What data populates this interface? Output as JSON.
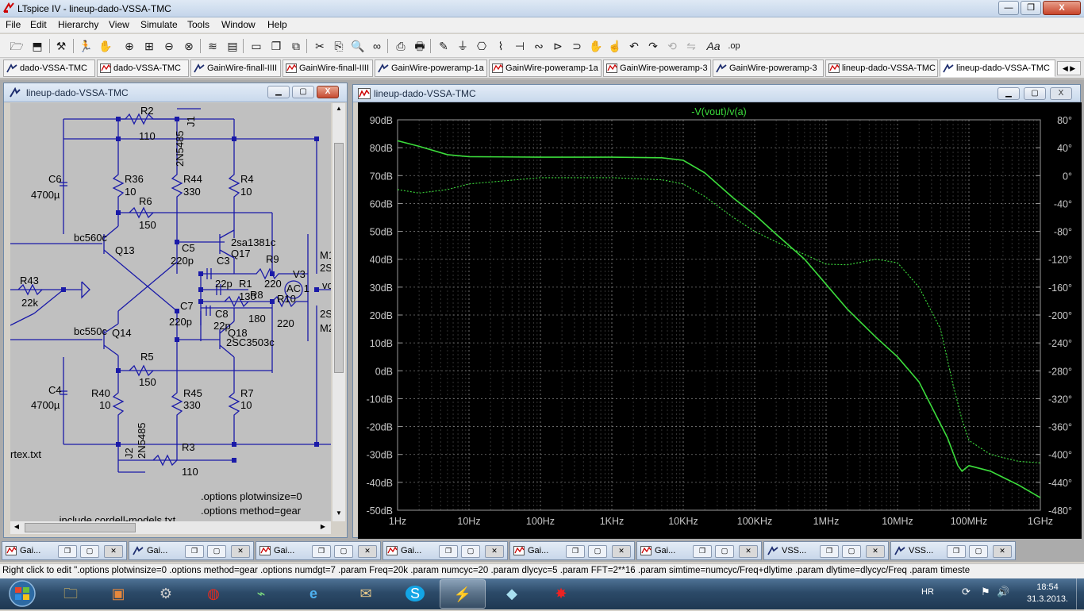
{
  "app": {
    "title": "LTspice IV - lineup-dado-VSSA-TMC",
    "window_buttons": {
      "minimize": "—",
      "maximize": "❐",
      "close": "X"
    }
  },
  "menu": [
    "File",
    "Edit",
    "Hierarchy",
    "View",
    "Simulate",
    "Tools",
    "Window",
    "Help"
  ],
  "toolbar": {
    "icons": [
      "open-icon",
      "save-icon",
      "settings-icon",
      "run-icon",
      "pan-icon",
      "zoom-in-icon",
      "zoom-area-icon",
      "zoom-out-icon",
      "zoom-cancel-icon",
      "autorange-icon",
      "tile-icon",
      "cascade-icon",
      "close-windows-icon",
      "cut-icon",
      "copy-icon",
      "find-icon",
      "binoculars-icon",
      "print-preview-icon",
      "print-icon",
      "draw-wire-icon",
      "ground-icon",
      "label-net-icon",
      "resistor-icon",
      "capacitor-icon",
      "inductor-icon",
      "diode-icon",
      "component-icon",
      "move-icon",
      "drag-icon",
      "undo-icon",
      "redo-icon",
      "rotate-icon",
      "mirror-icon",
      "text-icon",
      "spice-directive-icon"
    ],
    "text_buttons": {
      "text": "Aa",
      "directive": ".op"
    }
  },
  "doc_tabs": [
    {
      "label": "dado-VSSA-TMC",
      "type": "schematic"
    },
    {
      "label": "dado-VSSA-TMC",
      "type": "plot"
    },
    {
      "label": "GainWire-finall-IIII",
      "type": "schematic"
    },
    {
      "label": "GainWire-finall-IIII",
      "type": "plot"
    },
    {
      "label": "GainWire-poweramp-1a",
      "type": "schematic"
    },
    {
      "label": "GainWire-poweramp-1a",
      "type": "plot"
    },
    {
      "label": "GainWire-poweramp-3",
      "type": "plot"
    },
    {
      "label": "GainWire-poweramp-3",
      "type": "schematic"
    },
    {
      "label": "lineup-dado-VSSA-TMC",
      "type": "plot"
    },
    {
      "label": "lineup-dado-VSSA-TMC",
      "type": "schematic",
      "active": true
    }
  ],
  "schematic_window": {
    "title": "lineup-dado-VSSA-TMC",
    "labels": {
      "R2": "R2",
      "R2v": "110",
      "J1": "J1",
      "J1m": "2N5485",
      "C6": "C6",
      "C6v": "4700µ",
      "R36": "R36",
      "R36v": "10",
      "R44": "R44",
      "R44v": "330",
      "R4": "R4",
      "R4v": "10",
      "R6": "R6",
      "R6v": "150",
      "Q13m": "bc560c",
      "Q13": "Q13",
      "Q17m": "2sa1381c",
      "Q17": "Q17",
      "C5": "C5",
      "C5v": "220p",
      "C3": "C3",
      "C3v": "22p",
      "R9": "R9",
      "R9v": "220",
      "V3": "V3",
      "AC": "AC 1",
      "M1": "M1",
      "S1": "2S",
      "vo": "vo",
      "R43": "R43",
      "R43v": "22k",
      "R1": "R1",
      "R1v": "130",
      "R8": "R8",
      "R8v": "180",
      "R10": "R10",
      "R10v": "220",
      "S2": "2S",
      "M2": "M2",
      "C7": "C7",
      "C7v": "220p",
      "C8": "C8",
      "C8v": "22p",
      "Q18": "Q18",
      "Q18m": "2SC3503c",
      "Q14m": "bc550c",
      "Q14": "Q14",
      "R5": "R5",
      "R5v": "150",
      "C4": "C4",
      "C4v": "4700µ",
      "R40": "R40",
      "R40v": "10",
      "R45": "R45",
      "R45v": "330",
      "R7": "R7",
      "R7v": "10",
      "J2": "J2",
      "J2m": "2N5485",
      "R3": "R3",
      "R3v": "110",
      "rtex": "rtex.txt",
      "opt1": ".options plotwinsize=0",
      "opt2": ".options method=gear",
      "inc": ".include cordell-models.txt"
    }
  },
  "plot_window": {
    "title": "lineup-dado-VSSA-TMC",
    "trace_label": "-V(vout)/v(a)",
    "colors": {
      "trace": "#3cdc3c",
      "grid": "#8a8a8a",
      "background": "#000000",
      "axis_text": "#c8c8c8"
    }
  },
  "chart_data": {
    "type": "line",
    "title": "-V(vout)/v(a)",
    "x_scale": "log",
    "x_ticks": [
      "1Hz",
      "10Hz",
      "100Hz",
      "1KHz",
      "10KHz",
      "100KHz",
      "1MHz",
      "10MHz",
      "100MHz",
      "1GHz"
    ],
    "y_left_ticks": [
      "90dB",
      "80dB",
      "70dB",
      "60dB",
      "50dB",
      "40dB",
      "30dB",
      "20dB",
      "10dB",
      "0dB",
      "-10dB",
      "-20dB",
      "-30dB",
      "-40dB",
      "-50dB"
    ],
    "y_right_ticks": [
      "80°",
      "40°",
      "0°",
      "-40°",
      "-80°",
      "-120°",
      "-160°",
      "-200°",
      "-240°",
      "-280°",
      "-320°",
      "-360°",
      "-400°",
      "-440°",
      "-480°"
    ],
    "ylim_db": [
      -50,
      90
    ],
    "ylim_deg": [
      -480,
      80
    ],
    "grid": true,
    "series": [
      {
        "name": "magnitude",
        "unit": "dB",
        "style": "solid",
        "x": [
          1,
          2,
          5,
          10,
          100,
          1000,
          5000,
          10000,
          20000,
          50000,
          100000,
          200000,
          500000,
          1000000,
          2000000,
          5000000,
          10000000,
          20000000,
          50000000,
          70000000,
          80000000,
          100000000,
          200000000,
          500000000,
          1000000000
        ],
        "y": [
          82.5,
          80.5,
          77.5,
          76.8,
          76.6,
          76.6,
          76.4,
          75.5,
          71,
          62,
          56,
          49,
          40,
          31,
          22,
          12,
          5,
          -4,
          -24,
          -34,
          -36,
          -34,
          -36,
          -41,
          -45.5
        ]
      },
      {
        "name": "phase",
        "unit": "deg",
        "style": "dotted",
        "x": [
          1,
          2,
          5,
          10,
          100,
          1000,
          5000,
          10000,
          20000,
          50000,
          100000,
          200000,
          500000,
          1000000,
          2000000,
          5000000,
          10000000,
          20000000,
          40000000,
          60000000,
          80000000,
          100000000,
          200000000,
          500000000,
          1000000000
        ],
        "y": [
          -20,
          -25,
          -20,
          -12,
          -3,
          -3,
          -6,
          -12,
          -30,
          -60,
          -80,
          -95,
          -113,
          -127,
          -128,
          -120,
          -125,
          -160,
          -220,
          -300,
          -350,
          -380,
          -400,
          -410,
          -412
        ]
      }
    ]
  },
  "minimized_windows": [
    "Gai...",
    "Gai...",
    "Gai...",
    "Gai...",
    "Gai...",
    "Gai...",
    "VSS...",
    "VSS..."
  ],
  "status_text": "Right click to edit \".options plotwinsize=0  .options method=gear  .options numdgt=7  .param Freq=20k  .param numcyc=20  .param dlycyc=5  .param FFT=2**16  .param simtime=numcyc/Freq+dlytime  .param dlytime=dlycyc/Freq  .param timeste",
  "taskbar": {
    "apps": [
      "start-button",
      "explorer",
      "archive",
      "ltspice-probe",
      "antivirus",
      "oscilloscope",
      "internet-explorer",
      "mail",
      "skype",
      "ltspice",
      "notepad",
      "paint"
    ],
    "language": "HR",
    "time": "18:54",
    "date": "31.3.2013."
  }
}
